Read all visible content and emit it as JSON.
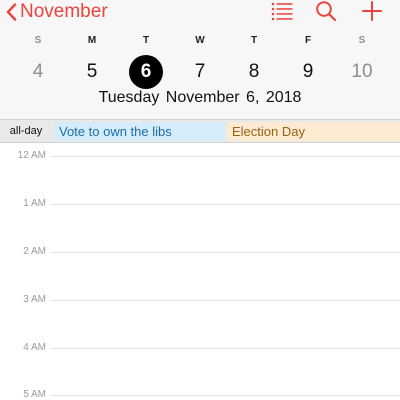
{
  "header": {
    "back_label": "November",
    "accent_color": "#e8453c"
  },
  "toolbar": {
    "icons": [
      "list-icon",
      "search-icon",
      "add-icon"
    ]
  },
  "week": {
    "days": [
      {
        "dow": "S",
        "num": "4"
      },
      {
        "dow": "M",
        "num": "5"
      },
      {
        "dow": "T",
        "num": "6"
      },
      {
        "dow": "W",
        "num": "7"
      },
      {
        "dow": "T",
        "num": "8"
      },
      {
        "dow": "F",
        "num": "9"
      },
      {
        "dow": "S",
        "num": "10"
      }
    ],
    "selected_index": 2,
    "selected_weekday": "Tuesday",
    "selected_date": "November 6, 2018"
  },
  "allday": {
    "label": "all-day",
    "events": [
      {
        "title": "Vote to own the libs",
        "color": "#d6ecfb"
      },
      {
        "title": "Election Day",
        "color": "#fcebd2"
      }
    ]
  },
  "timeline": {
    "hours": [
      "12 AM",
      "1 AM",
      "2 AM",
      "3 AM",
      "4 AM",
      "5 AM"
    ]
  }
}
